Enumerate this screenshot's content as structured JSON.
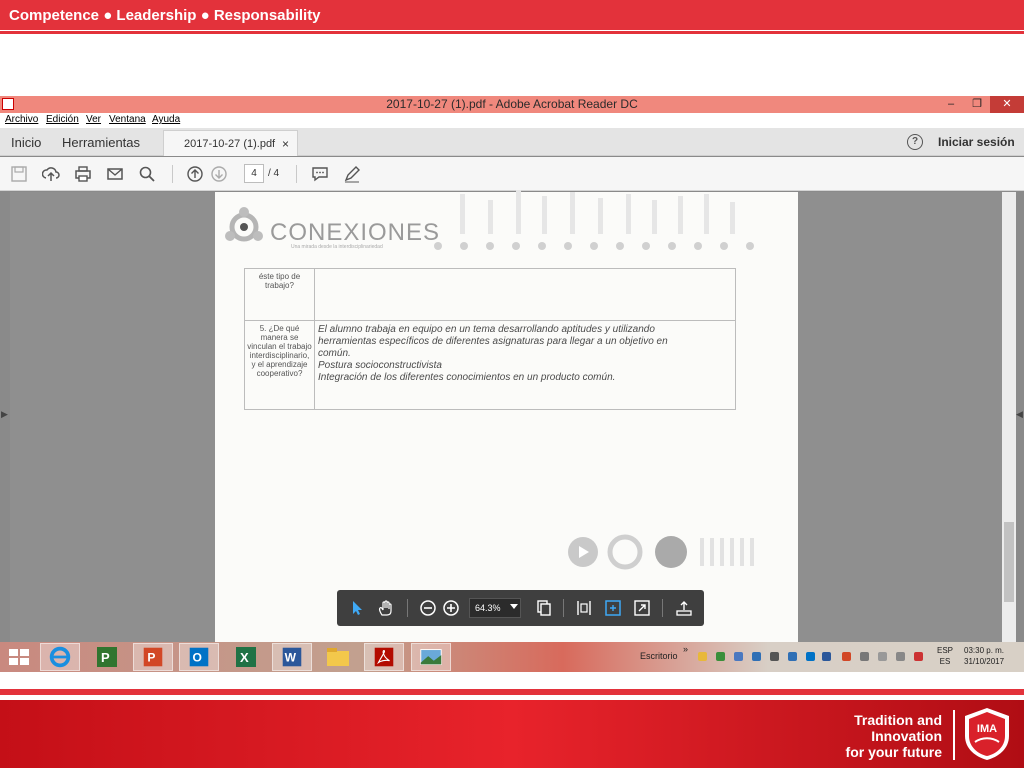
{
  "slide": {
    "header": "Competence ● Leadership ● Responsability",
    "slogan": [
      "Tradition and",
      "Innovation",
      "for your future"
    ],
    "logo_text": "IMA"
  },
  "window": {
    "title": "2017-10-27 (1).pdf - Adobe Acrobat Reader DC",
    "controls": {
      "minimize": "–",
      "maximize": "❐",
      "close": "✕"
    },
    "menu": [
      "Archivo",
      "Edición",
      "Ver",
      "Ventana",
      "Ayuda"
    ],
    "tabs": {
      "home": "Inicio",
      "tools": "Herramientas",
      "document": "2017-10-27 (1).pdf",
      "close": "×"
    },
    "help": "?",
    "signin": "Iniciar sesión",
    "page_current": "4",
    "page_total": "/  4",
    "zoom": "64.3%"
  },
  "document": {
    "logo_title": "CONEXIONES",
    "logo_subtitle": "Una mirada desde la interdisciplinariedad",
    "rows": [
      {
        "question": "éste tipo de trabajo?",
        "answer": ""
      },
      {
        "question": "5. ¿De qué manera se vinculan el trabajo interdisciplinario, y el aprendizaje cooperativo?",
        "answer_lines": [
          "El alumno trabaja en equipo en un tema desarrollando aptitudes y utilizando",
          "herramientas específicos de diferentes asignaturas para llegar a un objetivo en",
          "común.",
          "Postura socioconstructivista",
          "Integración de los diferentes conocimientos en un producto común."
        ]
      }
    ]
  },
  "taskbar": {
    "desktop_label": "Escritorio",
    "desktop_chevron": "»",
    "lang": [
      "ESP",
      "ES"
    ],
    "time": "03:30 p. m.",
    "date": "31/10/2017",
    "apps": [
      "windows-start",
      "internet-explorer",
      "project",
      "powerpoint",
      "outlook",
      "excel",
      "word",
      "file-explorer",
      "acrobat-reader",
      "photo-viewer"
    ]
  },
  "colors": {
    "brand_red": "#e3323b",
    "title_bar": "#f0887d",
    "acrobat_toolbar": "#f6f6f6"
  }
}
